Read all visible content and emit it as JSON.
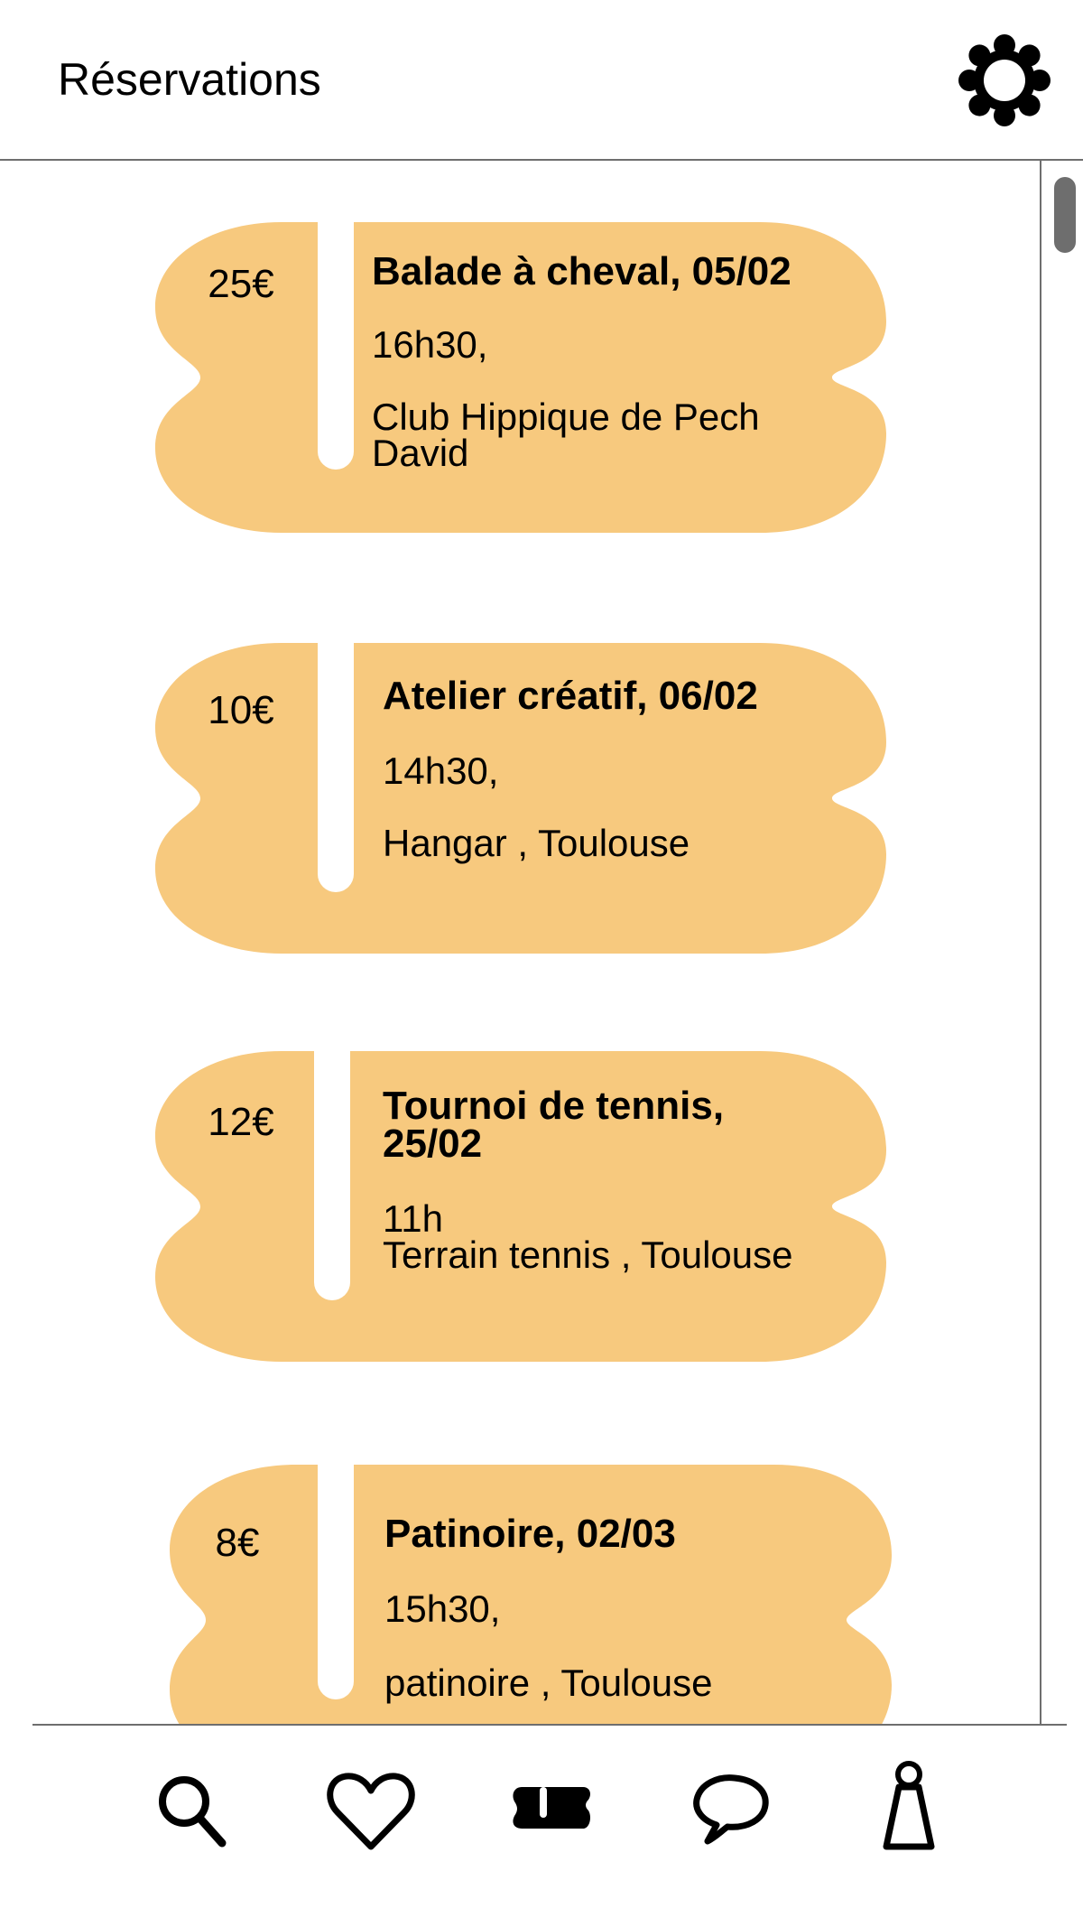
{
  "header": {
    "title": "Réservations",
    "settings_icon": "gear-icon"
  },
  "colors": {
    "card": "#F7C97E",
    "text": "#000000",
    "divider": "#6E6E6E",
    "background": "#FFFFFF"
  },
  "reservations": [
    {
      "price": "25€",
      "title": "Balade à cheval, 05/02",
      "time": "16h30,",
      "place": "Club Hippique de Pech David"
    },
    {
      "price": "10€",
      "title": "Atelier créatif, 06/02",
      "time": "14h30,",
      "place": "Hangar , Toulouse"
    },
    {
      "price": "12€",
      "title": "Tournoi de tennis, 25/02",
      "time": "11h",
      "place": "Terrain tennis , Toulouse"
    },
    {
      "price": "8€",
      "title": "Patinoire, 02/03",
      "time": "15h30,",
      "place": "patinoire , Toulouse"
    }
  ],
  "tabbar": {
    "items": [
      {
        "icon": "search-icon",
        "active": false
      },
      {
        "icon": "heart-icon",
        "active": false
      },
      {
        "icon": "ticket-icon",
        "active": true
      },
      {
        "icon": "chat-bubble-icon",
        "active": false
      },
      {
        "icon": "profile-icon",
        "active": false
      }
    ]
  }
}
